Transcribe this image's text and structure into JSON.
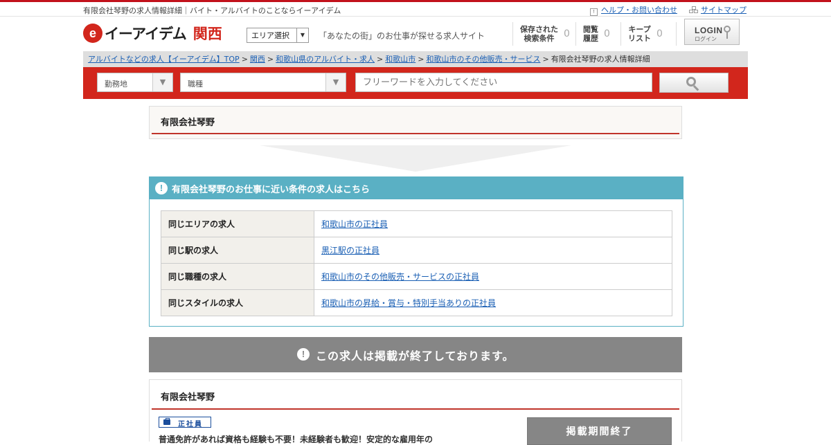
{
  "topbar": {
    "tagline": "有限会社琴野の求人情報詳細｜バイト・アルバイトのことならイーアイデム",
    "help_link": "ヘルプ・お問い合わせ",
    "sitemap_link": "サイトマップ"
  },
  "header": {
    "logo_mark": "e",
    "logo_text": "イーアイデム",
    "region": "関西",
    "area_select": "エリア選択",
    "catchphrase": "「あなたの街」のお仕事が探せる求人サイト",
    "saved_search": {
      "label1": "保存された",
      "label2": "検索条件",
      "count": "0"
    },
    "history": {
      "label1": "閲覧",
      "label2": "履歴",
      "count": "0"
    },
    "keep": {
      "label1": "キープ",
      "label2": "リスト",
      "count": "0"
    },
    "login": {
      "label": "LOGIN",
      "sublabel": "ログイン"
    }
  },
  "breadcrumb": {
    "items": [
      "アルバイトなどの求人【イーアイデム】TOP",
      "関西",
      "和歌山県のアルバイト・求人",
      "和歌山市",
      "和歌山市のその他販売・サービス"
    ],
    "current": "有限会社琴野の求人情報詳細",
    "separator": ">"
  },
  "search": {
    "location_select": "勤務地",
    "job_type_select": "職種",
    "keyword_placeholder": "フリーワードを入力してください"
  },
  "company_name": "有限会社琴野",
  "nearby": {
    "heading": "有限会社琴野のお仕事に近い条件の求人はこちら",
    "rows": [
      {
        "label": "同じエリアの求人",
        "link": "和歌山市の正社員"
      },
      {
        "label": "同じ駅の求人",
        "link": "黒江駅の正社員"
      },
      {
        "label": "同じ職種の求人",
        "link": "和歌山市のその他販売・サービスの正社員"
      },
      {
        "label": "同じスタイルの求人",
        "link": "和歌山市の昇給・賞与・特別手当ありの正社員"
      }
    ]
  },
  "ended_notice": "この求人は掲載が終了しております。",
  "detail": {
    "company_name": "有限会社琴野",
    "employment_badge": "正社員",
    "description": "普通免許があれば資格も経験も不要！未経験者も歓迎！安定的な雇用年の",
    "status_button": "掲載期間終了"
  },
  "colors": {
    "brand_red": "#d2261c",
    "teal": "#5ab0c4",
    "gray": "#868686",
    "badge_blue": "#1a4d9c"
  }
}
